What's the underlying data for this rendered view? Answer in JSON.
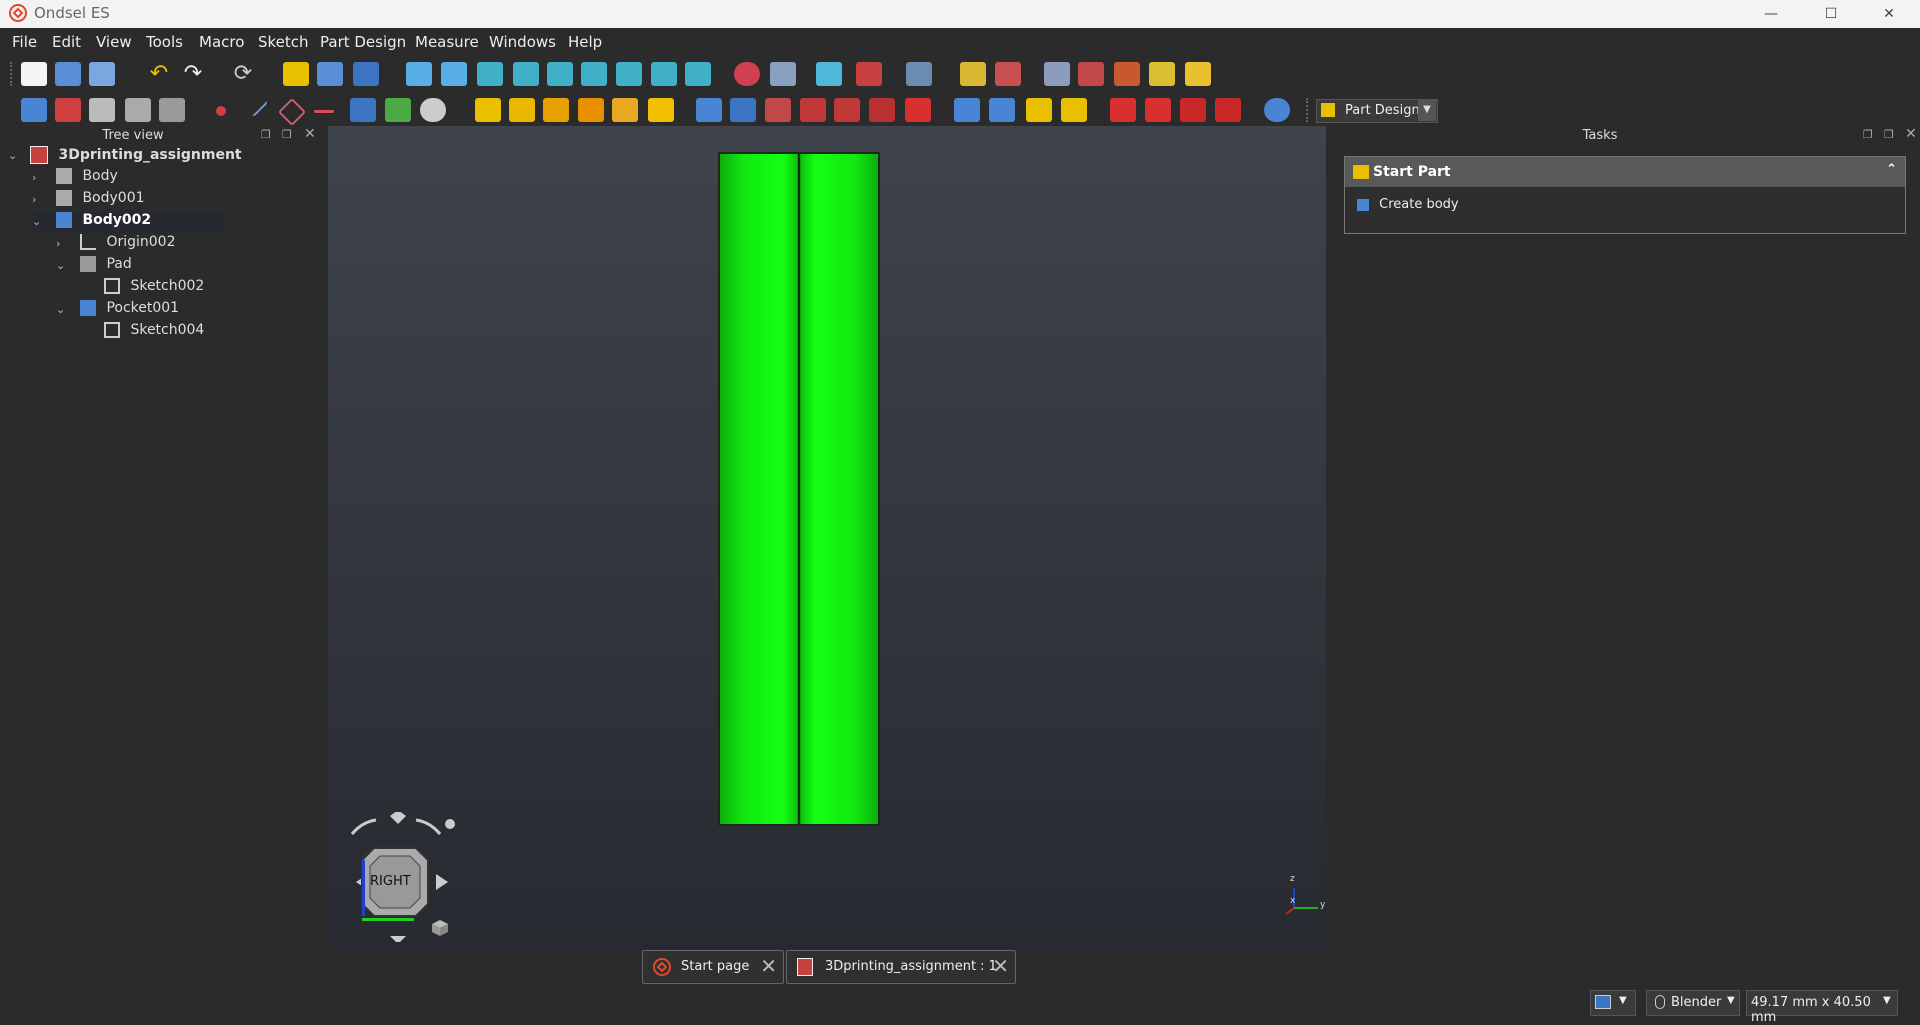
{
  "window": {
    "title": "Ondsel ES",
    "minimize": "—",
    "maximize": "☐",
    "close": "✕"
  },
  "menu": [
    "File",
    "Edit",
    "View",
    "Tools",
    "Macro",
    "Sketch",
    "Part Design",
    "Measure",
    "Windows",
    "Help"
  ],
  "workbench": {
    "selected": "Part Design"
  },
  "tree_view": {
    "title": "Tree view",
    "items": [
      {
        "label": "3Dprinting_assignment"
      },
      {
        "label": "Body"
      },
      {
        "label": "Body001"
      },
      {
        "label": "Body002"
      },
      {
        "label": "Origin002"
      },
      {
        "label": "Pad"
      },
      {
        "label": "Sketch002"
      },
      {
        "label": "Pocket001"
      },
      {
        "label": "Sketch004"
      }
    ]
  },
  "tasks": {
    "title": "Tasks",
    "section_title": "Start Part",
    "action": "Create body"
  },
  "navcube": {
    "face_label": "RIGHT"
  },
  "axis": {
    "z": "z",
    "y": "y",
    "x": "x"
  },
  "tabs": [
    {
      "label": "Start page"
    },
    {
      "label": "3Dprinting_assignment : 1"
    }
  ],
  "status": {
    "navigation_style": "Blender",
    "dimensions": "49.17 mm x 40.50 mm"
  },
  "colors": {
    "model": "#13ff13",
    "accent": "#f0d000"
  }
}
